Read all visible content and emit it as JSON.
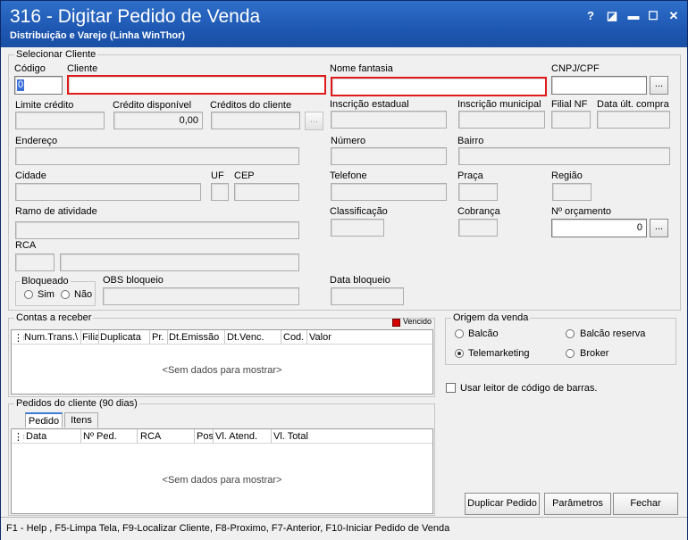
{
  "window": {
    "title": "316 - Digitar Pedido de Venda",
    "subtitle": "Distribuição e Varejo (Linha WinThor)",
    "controls": {
      "help": "?",
      "restore": "◪",
      "minimize": "▬",
      "maximize": "☐",
      "close": "✕"
    }
  },
  "cliente": {
    "group_label": "Selecionar Cliente",
    "codigo_label": "Código",
    "codigo_value": "0",
    "cliente_label": "Cliente",
    "fantasia_label": "Nome fantasia",
    "cnpj_label": "CNPJ/CPF",
    "limite_label": "Limite crédito",
    "credito_disp_label": "Crédito disponível",
    "credito_disp_value": "0,00",
    "creditos_label": "Créditos do cliente",
    "ie_label": "Inscrição estadual",
    "im_label": "Inscrição municipal",
    "filial_label": "Filial NF",
    "data_ult_label": "Data últ. compra",
    "endereco_label": "Endereço",
    "numero_label": "Número",
    "bairro_label": "Bairro",
    "cidade_label": "Cidade",
    "uf_label": "UF",
    "cep_label": "CEP",
    "telefone_label": "Telefone",
    "praca_label": "Praça",
    "regiao_label": "Região",
    "ramo_label": "Ramo de atividade",
    "classificacao_label": "Classificação",
    "cobranca_label": "Cobrança",
    "orcamento_label": "Nº orçamento",
    "orcamento_value": "0",
    "rca_label": "RCA",
    "bloqueado_label": "Bloqueado",
    "sim_label": "Sim",
    "nao_label": "Não",
    "obs_label": "OBS bloqueio",
    "data_bloq_label": "Data bloqueio",
    "ellipsis": "..."
  },
  "contas": {
    "label": "Contas a receber",
    "legend": "Vencido",
    "legend_color": "#d40000",
    "columns": [
      "Num.Trans.\\",
      "Filia",
      "Duplicata",
      "Pr.",
      "Dt.Emissão",
      "Dt.Venc.",
      "Cod.",
      "Valor"
    ],
    "empty": "<Sem dados para mostrar>"
  },
  "origem": {
    "label": "Origem da venda",
    "options": [
      "Balcão",
      "Balcão reserva",
      "Telemarketing",
      "Broker"
    ],
    "selected": "Telemarketing"
  },
  "barcode_label": "Usar leitor de código de barras.",
  "pedidos": {
    "label": "Pedidos do cliente (90 dias)",
    "tabs": [
      "Pedido",
      "Itens"
    ],
    "columns": [
      "Data",
      "Nº Ped.",
      "RCA",
      "Pos",
      "Vl. Atend.",
      "Vl. Total"
    ],
    "empty": "<Sem dados para mostrar>"
  },
  "buttons": {
    "duplicar": "Duplicar Pedido",
    "parametros": "Parâmetros",
    "fechar": "Fechar"
  },
  "status": "F1 - Help , F5-Limpa Tela, F9-Localizar Cliente, F8-Proximo, F7-Anterior, F10-Iniciar Pedido de Venda"
}
